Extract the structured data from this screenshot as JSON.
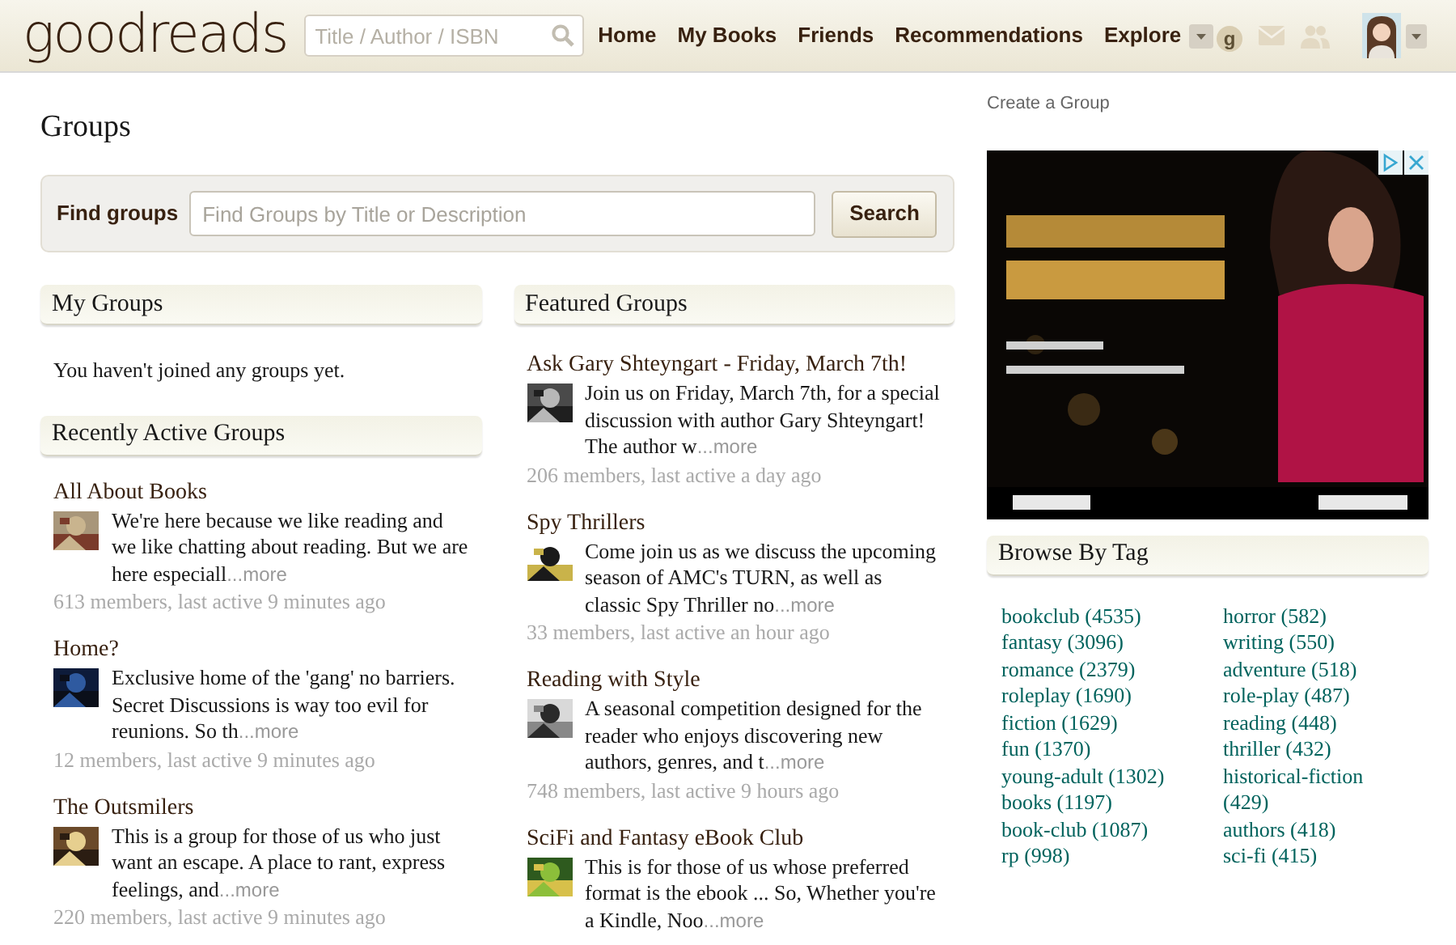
{
  "header": {
    "logo": "goodreads",
    "search": {
      "placeholder": "Title / Author / ISBN"
    },
    "nav": [
      "Home",
      "My Books",
      "Friends",
      "Recommendations",
      "Explore"
    ],
    "badge": "g"
  },
  "page_title": "Groups",
  "find_groups": {
    "label": "Find groups",
    "placeholder": "Find Groups by Title or Description",
    "button": "Search"
  },
  "my_groups": {
    "title": "My Groups",
    "message": "You haven't joined any groups yet."
  },
  "recently_active": {
    "title": "Recently Active Groups",
    "groups": [
      {
        "title": "All About Books",
        "description": "We're here because we like reading and we like chatting about reading. But we are here especiall",
        "more": "...more",
        "meta": "613 members, last active 9 minutes ago"
      },
      {
        "title": "Home?",
        "description": "Exclusive home of the 'gang' no barriers. Secret Discussions is way too evil for reunions. So th",
        "more": "...more",
        "meta": "12 members, last active 9 minutes ago"
      },
      {
        "title": "The Outsmilers",
        "description": "This is a group for those of us who just want an escape. A place to rant, express feelings, and",
        "more": "...more",
        "meta": "220 members, last active 9 minutes ago"
      }
    ]
  },
  "featured": {
    "title": "Featured Groups",
    "groups": [
      {
        "title": "Ask Gary Shteyngart - Friday, March 7th!",
        "description": "Join us on Friday, March 7th, for a special discussion with author Gary Shteyngart! The author w",
        "more": "...more",
        "meta": "206 members, last active a day ago"
      },
      {
        "title": "Spy Thrillers",
        "description": "Come join us as we discuss the upcoming season of AMC's TURN, as well as classic Spy Thriller no",
        "more": "...more",
        "meta": "33 members, last active an hour ago"
      },
      {
        "title": "Reading with Style",
        "description": "A seasonal competition designed for the reader who enjoys discovering new authors, genres, and t",
        "more": "...more",
        "meta": "748 members, last active 9 hours ago"
      },
      {
        "title": "SciFi and Fantasy eBook Club",
        "description": "This is for those of us whose preferred format is the ebook ... So, Whether you're a Kindle, Noo",
        "more": "...more"
      }
    ]
  },
  "create_link": "Create a Group",
  "browse_by_tag": {
    "title": "Browse By Tag",
    "columns": [
      [
        "bookclub (4535)",
        "fantasy (3096)",
        "romance (2379)",
        "roleplay (1690)",
        "fiction (1629)",
        "fun (1370)",
        "young-adult (1302)",
        "books (1197)",
        "book-club (1087)",
        "rp (998)"
      ],
      [
        "horror (582)",
        "writing (550)",
        "adventure (518)",
        "role-play (487)",
        "reading (448)",
        "thriller (432)",
        "historical-fiction (429)",
        "authors (418)",
        "sci-fi (415)"
      ]
    ]
  }
}
